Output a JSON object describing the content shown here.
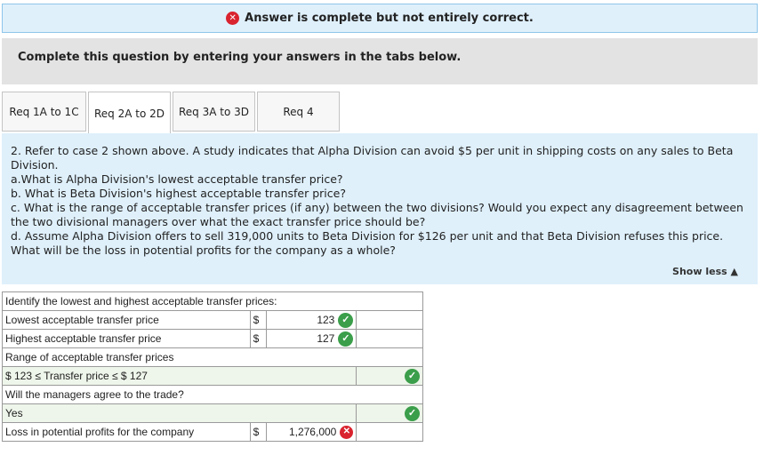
{
  "banner": {
    "text": "Answer is complete but not entirely correct."
  },
  "instruction": "Complete this question by entering your answers in the tabs below.",
  "tabs": [
    {
      "label": "Req 1A to 1C"
    },
    {
      "label": "Req 2A to 2D"
    },
    {
      "label": "Req 3A to 3D"
    },
    {
      "label": "Req 4"
    }
  ],
  "question": {
    "line1": "2. Refer to case 2 shown above. A study indicates that Alpha Division can avoid $5 per unit in shipping costs on any sales to Beta Division.",
    "line_a": "a.What is Alpha Division's lowest acceptable transfer price?",
    "line_b": "b. What is Beta Division's highest acceptable transfer price?",
    "line_c": "c. What is the range of acceptable transfer prices (if any) between the two divisions? Would you expect any disagreement between the two divisional managers over what the exact transfer price should be?",
    "line_d": "d. Assume Alpha Division offers to sell 319,000 units to Beta Division for $126 per unit and that Beta Division refuses this price. What will be the loss in potential profits for the company as a whole?",
    "show_less": "Show less"
  },
  "table": {
    "heading": "Identify the lowest and highest acceptable transfer prices:",
    "lowest_label": "Lowest acceptable transfer price",
    "lowest_currency": "$",
    "lowest_value": "123",
    "highest_label": "Highest acceptable transfer price",
    "highest_currency": "$",
    "highest_value": "127",
    "range_label": "Range of acceptable transfer prices",
    "range_value": "$ 123 ≤ Transfer price ≤ $ 127",
    "agree_label": "Will the managers agree to the trade?",
    "agree_value": "Yes",
    "loss_label": "Loss in potential profits for the company",
    "loss_currency": "$",
    "loss_value": "1,276,000"
  },
  "colors": {
    "banner_bg": "#dff0fb",
    "correct": "#3b9e4a",
    "incorrect": "#d9232e"
  }
}
